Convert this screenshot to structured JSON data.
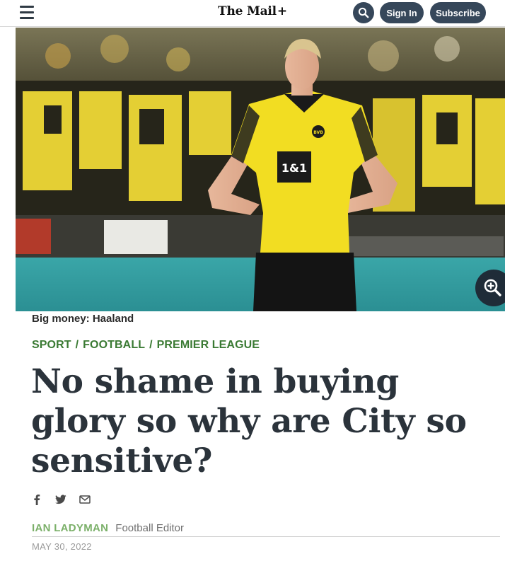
{
  "header": {
    "menu_icon": "hamburger-menu-icon",
    "logo_text": "The Mail",
    "logo_suffix": "+",
    "search_icon": "search-icon",
    "signin_label": "Sign In",
    "subscribe_label": "Subscribe"
  },
  "hero": {
    "shirt_sponsor": "1&1",
    "badge_text": "BVB",
    "zoom_icon": "zoom-in-icon"
  },
  "article": {
    "caption": "Big money: Haaland",
    "sections": [
      "SPORT",
      "FOOTBALL",
      "PREMIER LEAGUE"
    ],
    "section_separator": "/",
    "headline": "No shame in buying glory so why are City so sensitive?",
    "share_icons": [
      "facebook-icon",
      "twitter-icon",
      "email-icon"
    ],
    "author": "IAN LADYMAN",
    "author_role": "Football Editor",
    "date": "MAY 30, 2022"
  },
  "colors": {
    "header_button": "#36475a",
    "section_green": "#3a7a33",
    "author_green": "#7bb069",
    "headline": "#2b333b",
    "jersey_yellow": "#f2dd22"
  }
}
